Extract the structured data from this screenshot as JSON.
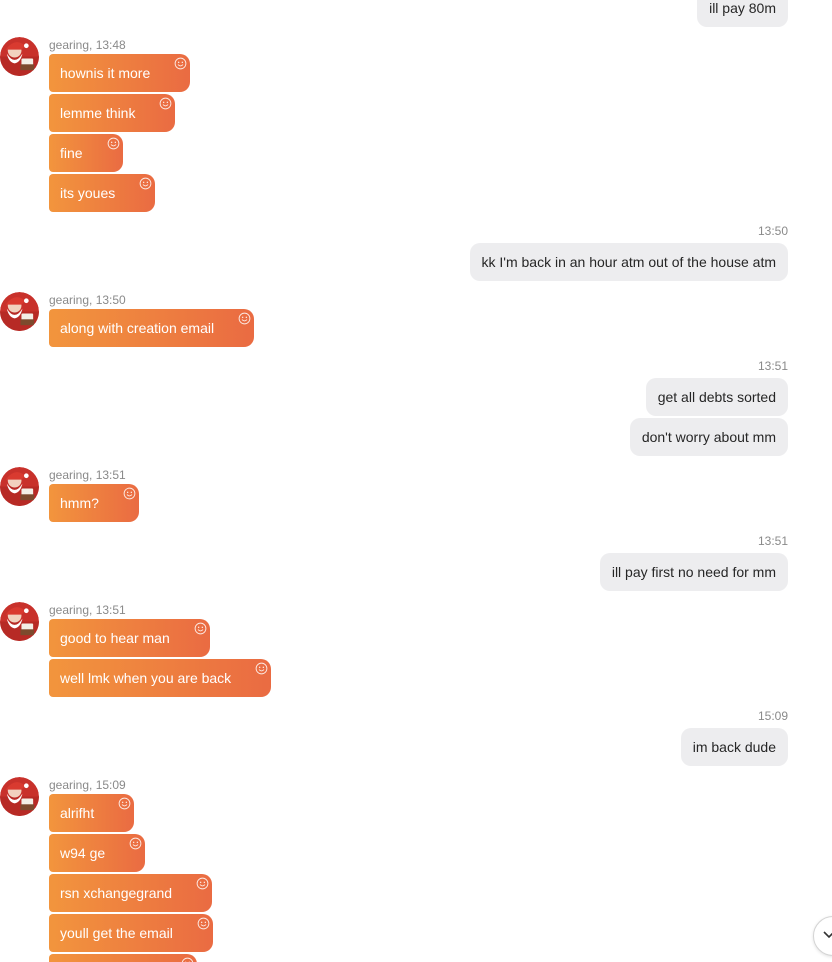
{
  "colors": {
    "incoming_gradient_start": "#f2953d",
    "incoming_gradient_end": "#ea6b42",
    "outgoing_bubble": "#ededef",
    "meta_text": "#8a8a8a"
  },
  "chat": {
    "contact_name": "gearing",
    "messages": [
      {
        "direction": "out",
        "text": "ill pay 80m"
      },
      {
        "direction": "in",
        "sender": "gearing",
        "meta": "gearing, 13:48",
        "texts": [
          "hownis it more",
          "lemme think",
          "fine",
          "its youes"
        ]
      },
      {
        "direction": "out",
        "time": "13:50",
        "texts": [
          "kk I'm back in an hour atm out of the house atm"
        ]
      },
      {
        "direction": "in",
        "sender": "gearing",
        "meta": "gearing, 13:50",
        "texts": [
          "along with creation email"
        ]
      },
      {
        "direction": "out",
        "time": "13:51",
        "texts": [
          "get all debts sorted",
          "don't worry about mm"
        ]
      },
      {
        "direction": "in",
        "sender": "gearing",
        "meta": "gearing, 13:51",
        "texts": [
          "hmm?"
        ]
      },
      {
        "direction": "out",
        "time": "13:51",
        "texts": [
          "ill pay first no need for mm"
        ]
      },
      {
        "direction": "in",
        "sender": "gearing",
        "meta": "gearing, 13:51",
        "texts": [
          "good to hear man",
          "well lmk when you are back"
        ]
      },
      {
        "direction": "out",
        "time": "15:09",
        "texts": [
          "im back dude"
        ]
      },
      {
        "direction": "in",
        "sender": "gearing",
        "meta": "gearing, 15:09",
        "texts": [
          "alrifht",
          "w94 ge",
          "rsn xchangegrand",
          "youll get the email"
        ]
      }
    ]
  },
  "icons": {
    "reaction": "smiley-icon",
    "avatar": "santa-avatar",
    "scroll": "chevron-down-icon"
  }
}
